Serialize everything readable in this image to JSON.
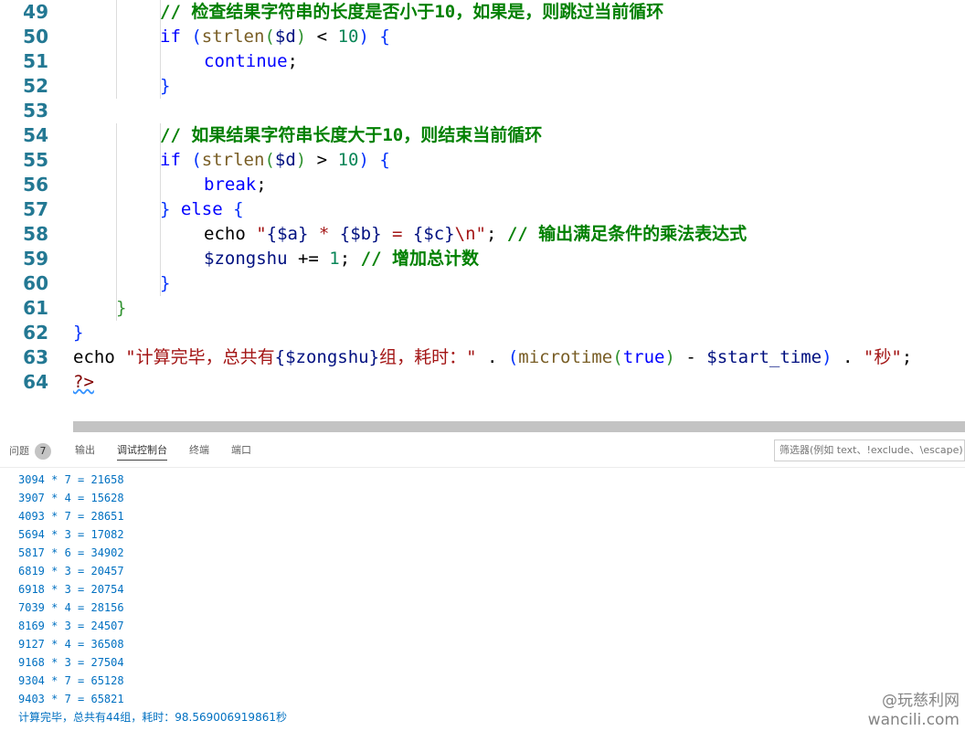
{
  "editor": {
    "lines": [
      {
        "n": "49",
        "indent": 4,
        "tokens": [
          {
            "t": "// 检查结果字符串的长度是否小于10，如果是，则跳过当前循环",
            "c": "cm"
          }
        ]
      },
      {
        "n": "50",
        "indent": 4,
        "tokens": [
          {
            "t": "if",
            "c": "ctl"
          },
          {
            "t": " "
          },
          {
            "t": "(",
            "c": "p2"
          },
          {
            "t": "strlen",
            "c": "fn"
          },
          {
            "t": "(",
            "c": "p3"
          },
          {
            "t": "$d",
            "c": "var"
          },
          {
            "t": ")",
            "c": "p3"
          },
          {
            "t": " < "
          },
          {
            "t": "10",
            "c": "num"
          },
          {
            "t": ")",
            "c": "p2"
          },
          {
            "t": " "
          },
          {
            "t": "{",
            "c": "p2"
          }
        ]
      },
      {
        "n": "51",
        "indent": 6,
        "tokens": [
          {
            "t": "continue",
            "c": "ctl"
          },
          {
            "t": ";"
          }
        ]
      },
      {
        "n": "52",
        "indent": 4,
        "tokens": [
          {
            "t": "}",
            "c": "p2"
          }
        ]
      },
      {
        "n": "53",
        "indent": 0,
        "tokens": []
      },
      {
        "n": "54",
        "indent": 4,
        "tokens": [
          {
            "t": "// 如果结果字符串长度大于10，则结束当前循环",
            "c": "cm"
          }
        ]
      },
      {
        "n": "55",
        "indent": 4,
        "tokens": [
          {
            "t": "if",
            "c": "ctl"
          },
          {
            "t": " "
          },
          {
            "t": "(",
            "c": "p2"
          },
          {
            "t": "strlen",
            "c": "fn"
          },
          {
            "t": "(",
            "c": "p3"
          },
          {
            "t": "$d",
            "c": "var"
          },
          {
            "t": ")",
            "c": "p3"
          },
          {
            "t": " > "
          },
          {
            "t": "10",
            "c": "num"
          },
          {
            "t": ")",
            "c": "p2"
          },
          {
            "t": " "
          },
          {
            "t": "{",
            "c": "p2"
          }
        ]
      },
      {
        "n": "56",
        "indent": 6,
        "tokens": [
          {
            "t": "break",
            "c": "ctl"
          },
          {
            "t": ";"
          }
        ]
      },
      {
        "n": "57",
        "indent": 4,
        "tokens": [
          {
            "t": "}",
            "c": "p2"
          },
          {
            "t": " "
          },
          {
            "t": "else",
            "c": "ctl"
          },
          {
            "t": " "
          },
          {
            "t": "{",
            "c": "p2"
          }
        ]
      },
      {
        "n": "58",
        "indent": 6,
        "tokens": [
          {
            "t": "echo"
          },
          {
            "t": " "
          },
          {
            "t": "\"",
            "c": "str"
          },
          {
            "t": "{$a}",
            "c": "var"
          },
          {
            "t": " * ",
            "c": "str"
          },
          {
            "t": "{$b}",
            "c": "var"
          },
          {
            "t": " = ",
            "c": "str"
          },
          {
            "t": "{$c}",
            "c": "var"
          },
          {
            "t": "\\n\"",
            "c": "str"
          },
          {
            "t": "; "
          },
          {
            "t": "// 输出满足条件的乘法表达式",
            "c": "cm"
          }
        ]
      },
      {
        "n": "59",
        "indent": 6,
        "tokens": [
          {
            "t": "$zongshu",
            "c": "var"
          },
          {
            "t": " += "
          },
          {
            "t": "1",
            "c": "num"
          },
          {
            "t": "; "
          },
          {
            "t": "// 增加总计数",
            "c": "cm"
          }
        ]
      },
      {
        "n": "60",
        "indent": 4,
        "tokens": [
          {
            "t": "}",
            "c": "p2"
          }
        ]
      },
      {
        "n": "61",
        "indent": 2,
        "tokens": [
          {
            "t": "}",
            "c": "p3"
          }
        ]
      },
      {
        "n": "62",
        "indent": 0,
        "tokens": [
          {
            "t": "}",
            "c": "p2"
          }
        ]
      },
      {
        "n": "63",
        "indent": 0,
        "tokens": [
          {
            "t": "echo"
          },
          {
            "t": " "
          },
          {
            "t": "\"计算完毕，总共有",
            "c": "str"
          },
          {
            "t": "{$zongshu}",
            "c": "var"
          },
          {
            "t": "组，耗时：\"",
            "c": "str"
          },
          {
            "t": " . "
          },
          {
            "t": "(",
            "c": "p2"
          },
          {
            "t": "microtime",
            "c": "fn"
          },
          {
            "t": "(",
            "c": "p3"
          },
          {
            "t": "true",
            "c": "kw"
          },
          {
            "t": ")",
            "c": "p3"
          },
          {
            "t": " - "
          },
          {
            "t": "$start_time",
            "c": "var"
          },
          {
            "t": ")",
            "c": "p2"
          },
          {
            "t": " . "
          },
          {
            "t": "\"秒\"",
            "c": "str"
          },
          {
            "t": ";"
          }
        ]
      },
      {
        "n": "64",
        "indent": 0,
        "tokens": [
          {
            "t": "?>",
            "c": "tag",
            "sq": true
          }
        ]
      }
    ]
  },
  "panel": {
    "tabs": [
      {
        "label": "问题",
        "badge": "7"
      },
      {
        "label": "输出"
      },
      {
        "label": "调试控制台",
        "active": true
      },
      {
        "label": "终端"
      },
      {
        "label": "端口"
      }
    ],
    "filter_placeholder": "筛选器(例如 text、!exclude、\\escape)",
    "output": [
      "3094 * 7 = 21658",
      "3907 * 4 = 15628",
      "4093 * 7 = 28651",
      "5694 * 3 = 17082",
      "5817 * 6 = 34902",
      "6819 * 3 = 20457",
      "6918 * 3 = 20754",
      "7039 * 4 = 28156",
      "8169 * 3 = 24507",
      "9127 * 4 = 36508",
      "9168 * 3 = 27504",
      "9304 * 7 = 65128",
      "9403 * 7 = 65821",
      "计算完毕，总共有44组，耗时：98.569006919861秒"
    ]
  },
  "watermark": {
    "line1": "@玩慈利网",
    "line2": "wancili.com"
  }
}
